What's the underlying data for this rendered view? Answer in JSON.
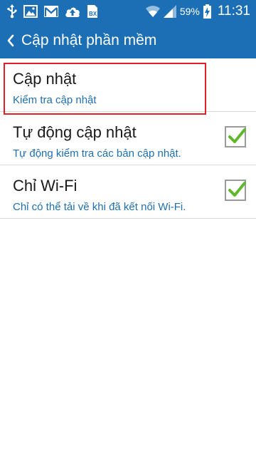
{
  "status_bar": {
    "battery_percent": "59%",
    "time": "11:31",
    "icons": [
      "usb-icon",
      "gallery-icon",
      "gmail-icon",
      "cloud-upload-icon",
      "bx-icon",
      "wifi-icon",
      "signal-icon",
      "battery-icon"
    ]
  },
  "header": {
    "title": "Cập nhật phần mềm",
    "back_icon": "chevron-left-icon"
  },
  "items": [
    {
      "title": "Cập nhật",
      "subtitle": "Kiểm tra cập nhật",
      "has_checkbox": false
    },
    {
      "title": "Tự động cập nhật",
      "subtitle": "Tự động kiểm tra các bản cập nhật.",
      "checked": true
    },
    {
      "title": "Chỉ Wi-Fi",
      "subtitle": "Chỉ có thể tải về khi đã kết nối Wi-Fi.",
      "checked": true
    }
  ],
  "colors": {
    "header_bg": "#1c6fb4",
    "subtitle": "#1f6fb0",
    "check": "#5fb82c",
    "highlight": "#e21f26"
  }
}
